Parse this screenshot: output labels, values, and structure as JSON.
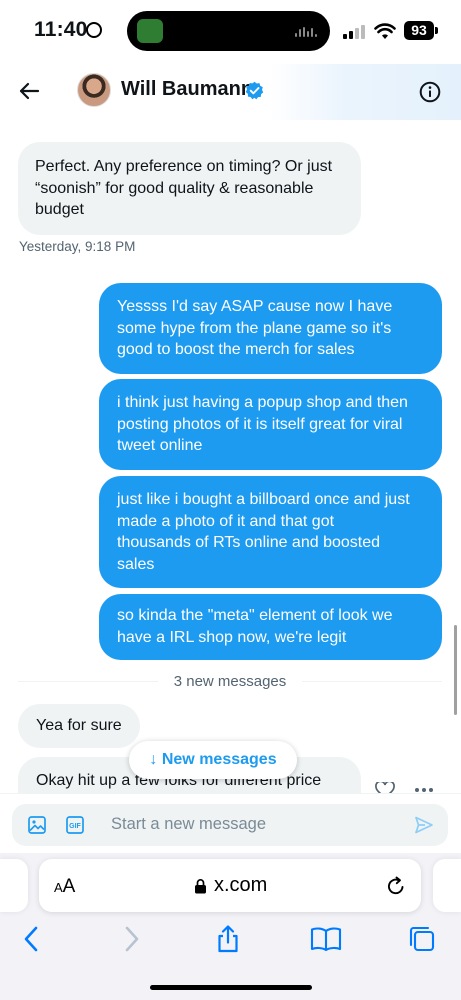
{
  "status_bar": {
    "time": "11:40",
    "battery": "93"
  },
  "header": {
    "contact_name": "Will Baumann"
  },
  "messages": [
    {
      "type": "received",
      "text": "Perfect. Any preference on timing? Or just\n“soonish” for good quality & reasonable\nbudget"
    },
    {
      "type": "timestamp",
      "text": "Yesterday, 9:18 PM"
    },
    {
      "type": "sent",
      "text": "Yessss I'd say ASAP cause now I have\nsome hype from the plane game so it's\ngood to boost the merch for sales"
    },
    {
      "type": "sent",
      "text": "i think just having a popup shop and then\nposting photos of it is itself great for viral\ntweet online"
    },
    {
      "type": "sent",
      "text": "just like i bought a billboard once and just\nmade a photo of it and that got\nthousands of RTs online and boosted\nsales"
    },
    {
      "type": "sent",
      "text": "so kinda the \"meta\" element of look we\nhave a IRL shop now, we're legit"
    },
    {
      "type": "divider",
      "text": "3 new messages"
    },
    {
      "type": "received",
      "text": "Yea for sure"
    },
    {
      "type": "received",
      "text": "Okay hit up a few folks for different price"
    }
  ],
  "new_messages_button": "↓ New messages",
  "compose": {
    "placeholder": "Start a new message"
  },
  "browser": {
    "text_size_label": "AA",
    "url": "x.com"
  },
  "colors": {
    "accent": "#1d9bf0",
    "received_bubble": "#eff3f4",
    "muted": "#536471"
  }
}
